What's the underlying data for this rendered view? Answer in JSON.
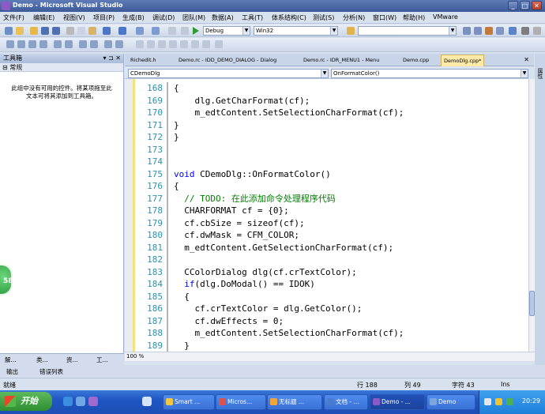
{
  "window": {
    "title": "Demo - Microsoft Visual Studio",
    "caption_minimize": "_",
    "caption_restore": "□",
    "caption_close": "✕"
  },
  "menu": [
    "文件(F)",
    "编辑(E)",
    "视图(V)",
    "项目(P)",
    "生成(B)",
    "调试(D)",
    "团队(M)",
    "数据(A)",
    "工具(T)",
    "体系结构(C)",
    "测试(S)",
    "分析(N)",
    "窗口(W)",
    "帮助(H)",
    "VMware"
  ],
  "toolbar": {
    "config": "Debug",
    "platform": "Win32",
    "find_value": ""
  },
  "toolbox": {
    "title": "工具箱",
    "pin": "▾ ⊐ ✕",
    "group": "常规",
    "group_toggle": "⊟",
    "empty_message_line1": "此组中没有可用的控件。将某项拖至此",
    "empty_message_line2": "文本可将其添加到工具箱。",
    "tabs": [
      "解...",
      "类...",
      "资...",
      "工..."
    ]
  },
  "document_tabs": [
    {
      "label": "Richedit.h",
      "active": false
    },
    {
      "label": "Demo.rc - IDD_DEMO_DIALOG - Dialog",
      "active": false
    },
    {
      "label": "Demo.rc - IDR_MENU1 - Menu",
      "active": false
    },
    {
      "label": "Demo.cpp",
      "active": false
    },
    {
      "label": "DemoDlg.cpp*",
      "active": true
    }
  ],
  "document_tab_close": "✕",
  "navigation": {
    "class_combo": "CDemoDlg",
    "member_combo": "OnFormatColor()"
  },
  "editor": {
    "lines": [
      {
        "num": "168",
        "code": "{"
      },
      {
        "num": "169",
        "code": "    dlg.GetCharFormat(cf);"
      },
      {
        "num": "170",
        "code": "    m_edtContent.SetSelectionCharFormat(cf);"
      },
      {
        "num": "171",
        "code": "}"
      },
      {
        "num": "172",
        "code": "}"
      },
      {
        "num": "173",
        "code": ""
      },
      {
        "num": "174",
        "code": ""
      },
      {
        "num": "175",
        "code": "void CDemoDlg::OnFormatColor()"
      },
      {
        "num": "176",
        "code": "{"
      },
      {
        "num": "177",
        "code": "  // TODO: 在此添加命令处理程序代码"
      },
      {
        "num": "178",
        "code": "  CHARFORMAT cf = {0};"
      },
      {
        "num": "179",
        "code": "  cf.cbSize = sizeof(cf);"
      },
      {
        "num": "180",
        "code": "  cf.dwMask = CFM_COLOR;"
      },
      {
        "num": "181",
        "code": "  m_edtContent.GetSelectionCharFormat(cf);"
      },
      {
        "num": "182",
        "code": ""
      },
      {
        "num": "183",
        "code": "  CColorDialog dlg(cf.crTextColor);"
      },
      {
        "num": "184",
        "code": "  if(dlg.DoModal() == IDOK)"
      },
      {
        "num": "185",
        "code": "  {"
      },
      {
        "num": "186",
        "code": "    cf.crTextColor = dlg.GetColor();"
      },
      {
        "num": "187",
        "code": "    cf.dwEffects = 0;"
      },
      {
        "num": "188",
        "code": "    m_edtContent.SetSelectionCharFormat(cf);"
      },
      {
        "num": "189",
        "code": "  }"
      }
    ],
    "zoom": "100 %"
  },
  "right_rail": {
    "label": "属性"
  },
  "output_tabs": [
    "输出",
    "错误列表"
  ],
  "status": {
    "ready": "就绪",
    "line": "行 188",
    "col": "列 49",
    "char": "字符 43",
    "mode": "Ins"
  },
  "side_badge": "58",
  "taskbar": {
    "start": "开始",
    "tasks": [
      {
        "label": "Smart ...",
        "active": false
      },
      {
        "label": "Micros...",
        "active": false
      },
      {
        "label": "无标题 ...",
        "active": false
      },
      {
        "label": "文档 - ...",
        "active": false
      },
      {
        "label": "Demo - ...",
        "active": true
      },
      {
        "label": "Demo",
        "active": false
      }
    ],
    "clock": "20:29"
  },
  "colors": {
    "keyword": "#0000ff",
    "comment": "#008000",
    "line_number": "#2b91af",
    "active_tab": "#fde9a8"
  }
}
